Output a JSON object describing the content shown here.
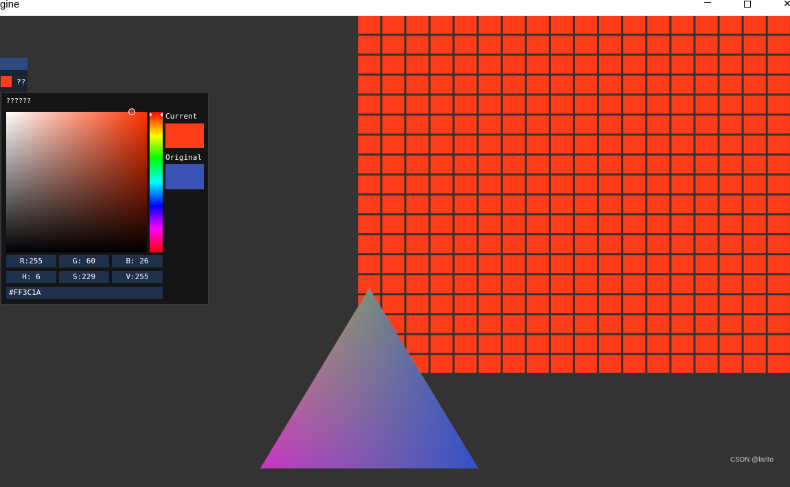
{
  "window": {
    "title": "gine",
    "minimize_icon": "minimize-icon",
    "maximize_icon": "maximize-icon",
    "close_icon": "close-icon",
    "close_glyph": "✕"
  },
  "imgui_window": {
    "color_button_label": "??",
    "color_button_value": "#FF3C1A"
  },
  "color_picker": {
    "title": "??????",
    "current_label": "Current",
    "original_label": "Original",
    "current_color": "#ff3c1a",
    "original_color": "#3a52b4",
    "fields": {
      "r": "R:255",
      "g": "G: 60",
      "b": "B: 26",
      "h": "H:  6",
      "s": "S:229",
      "v": "V:255",
      "hex": "#FF3C1A"
    }
  },
  "scene": {
    "background_color": "#333333",
    "quad_color": "#ff3c1a",
    "triangle_colors": {
      "top": "#c8c832",
      "bottom_left": "#c832c8",
      "bottom_right": "#3250c8"
    }
  },
  "watermark": "CSDN @larito"
}
